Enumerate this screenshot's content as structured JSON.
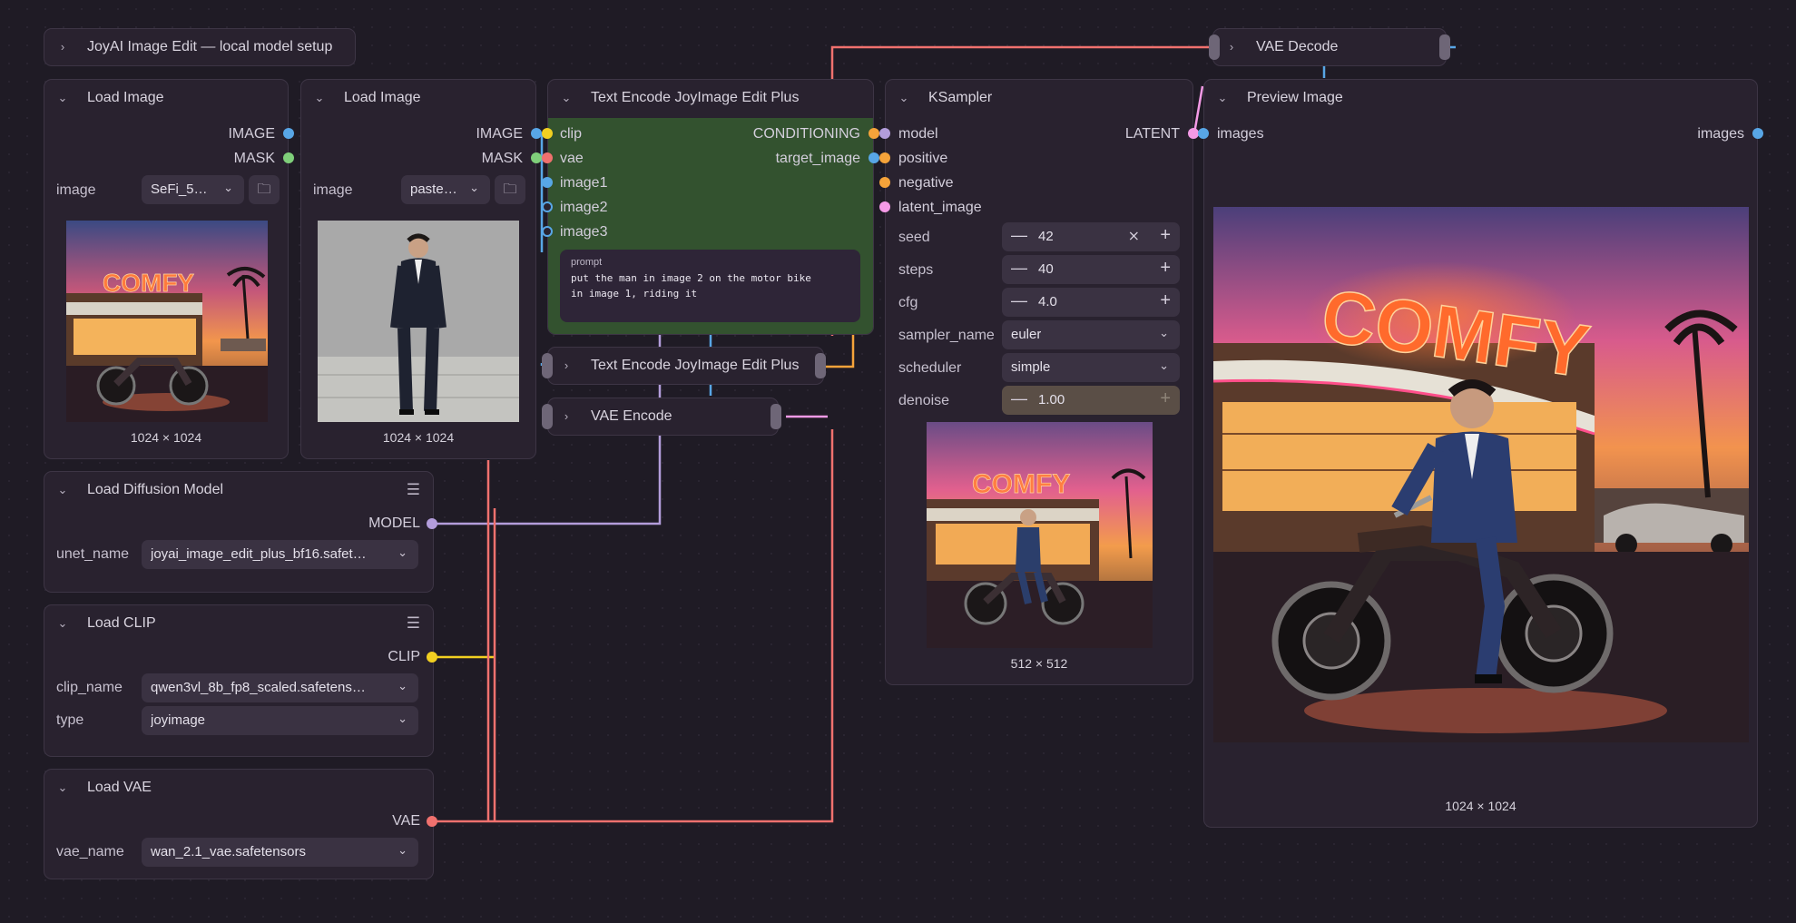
{
  "group": {
    "title": "JoyAI Image Edit — local model setup"
  },
  "load_image_1": {
    "title": "Load Image",
    "outputs": [
      "IMAGE",
      "MASK"
    ],
    "image_label": "image",
    "image_value": "SeFi_5…",
    "caption": "1024 × 1024",
    "thumbnail": "neon COMFY diner at sunset with motorcycle"
  },
  "load_image_2": {
    "title": "Load Image",
    "outputs": [
      "IMAGE",
      "MASK"
    ],
    "image_label": "image",
    "image_value": "paste…",
    "caption": "1024 × 1024",
    "thumbnail": "man in dark suit standing"
  },
  "text_encode": {
    "title": "Text Encode JoyImage Edit Plus",
    "inputs": [
      "clip",
      "vae",
      "image1",
      "image2",
      "image3"
    ],
    "outputs": [
      "CONDITIONING",
      "target_image"
    ],
    "prompt_label": "prompt",
    "prompt_text": "put the man in image 2 on the motor bike\nin image 1, riding it"
  },
  "text_encode_collapsed": {
    "title": "Text Encode JoyImage Edit Plus"
  },
  "vae_encode": {
    "title": "VAE Encode"
  },
  "vae_decode": {
    "title": "VAE Decode"
  },
  "ksampler": {
    "title": "KSampler",
    "inputs": [
      "model",
      "positive",
      "negative",
      "latent_image"
    ],
    "output": "LATENT",
    "seed_label": "seed",
    "seed": "42",
    "steps_label": "steps",
    "steps": "40",
    "cfg_label": "cfg",
    "cfg": "4.0",
    "sampler_label": "sampler_name",
    "sampler": "euler",
    "scheduler_label": "scheduler",
    "scheduler": "simple",
    "denoise_label": "denoise",
    "denoise": "1.00",
    "caption": "512 × 512"
  },
  "preview": {
    "title": "Preview Image",
    "input": "images",
    "output": "images",
    "caption": "1024 × 1024"
  },
  "load_diffusion": {
    "title": "Load Diffusion Model",
    "output": "MODEL",
    "label": "unet_name",
    "value": "joyai_image_edit_plus_bf16.safet…"
  },
  "load_clip": {
    "title": "Load CLIP",
    "output": "CLIP",
    "name_label": "clip_name",
    "name_value": "qwen3vl_8b_fp8_scaled.safetens…",
    "type_label": "type",
    "type_value": "joyimage"
  },
  "load_vae": {
    "title": "Load VAE",
    "output": "VAE",
    "label": "vae_name",
    "value": "wan_2.1_vae.safetensors"
  },
  "colors": {
    "image": "#58a6e6",
    "mask": "#7fcf7a",
    "clip": "#f2d021",
    "vae": "#f0716e",
    "model": "#b39ddb",
    "conditioning": "#f5a33a",
    "latent": "#f49ae6",
    "node_bg": "#29222f",
    "green_body": "#33522f",
    "canvas": "#1f1b25"
  }
}
